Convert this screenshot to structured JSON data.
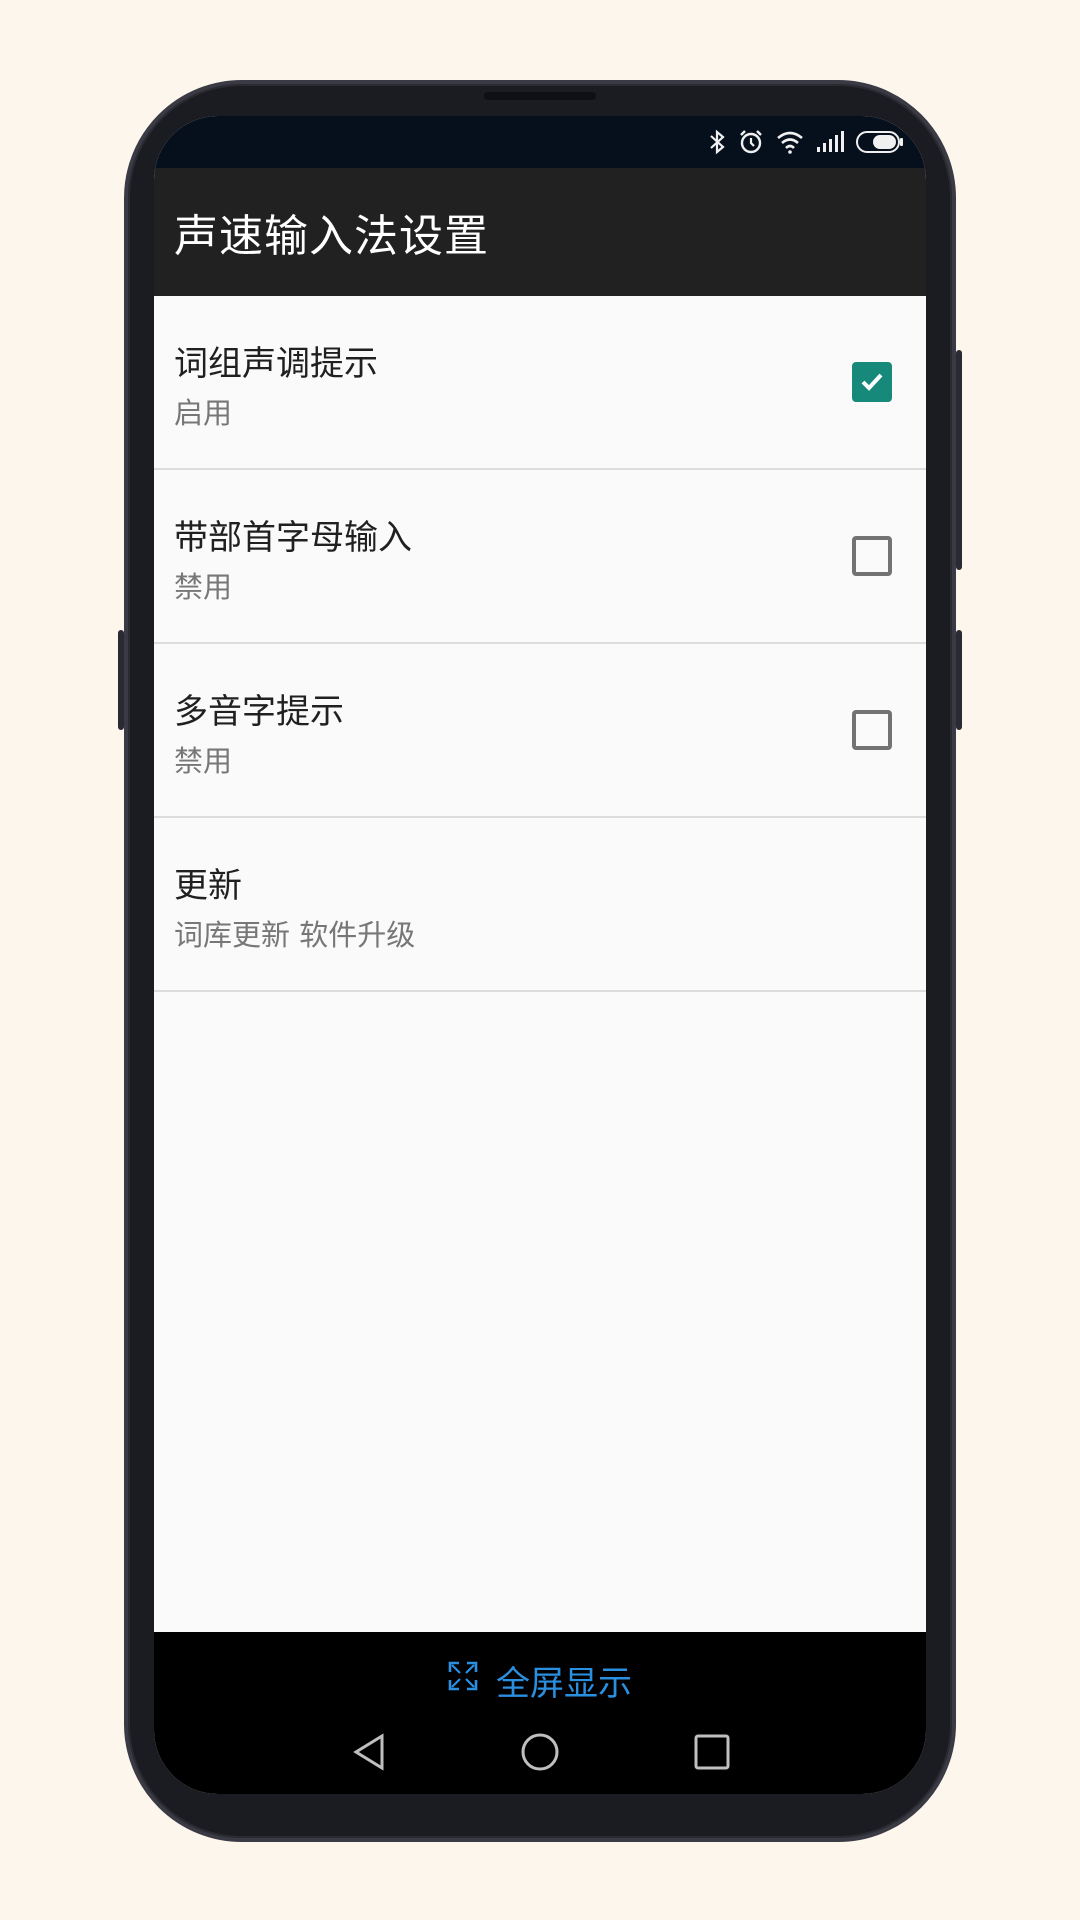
{
  "app_bar": {
    "title": "声速输入法设置"
  },
  "settings": [
    {
      "title": "词组声调提示",
      "summary": "启用",
      "checked": true
    },
    {
      "title": "带部首字母输入",
      "summary": "禁用",
      "checked": false
    },
    {
      "title": "多音字提示",
      "summary": "禁用",
      "checked": false
    },
    {
      "title": "更新",
      "summary": "词库更新 软件升级"
    }
  ],
  "fullscreen": {
    "label": "全屏显示",
    "icon": "expand-icon",
    "color": "#2b8fe0"
  },
  "status_icons": [
    "bluetooth-icon",
    "alarm-icon",
    "wifi-icon",
    "signal-icon",
    "battery-icon"
  ],
  "nav_buttons": [
    "back-icon",
    "home-icon",
    "recents-icon"
  ],
  "colors": {
    "accent": "#17897a",
    "app_bar": "#212121",
    "status_bar": "#06101d"
  }
}
